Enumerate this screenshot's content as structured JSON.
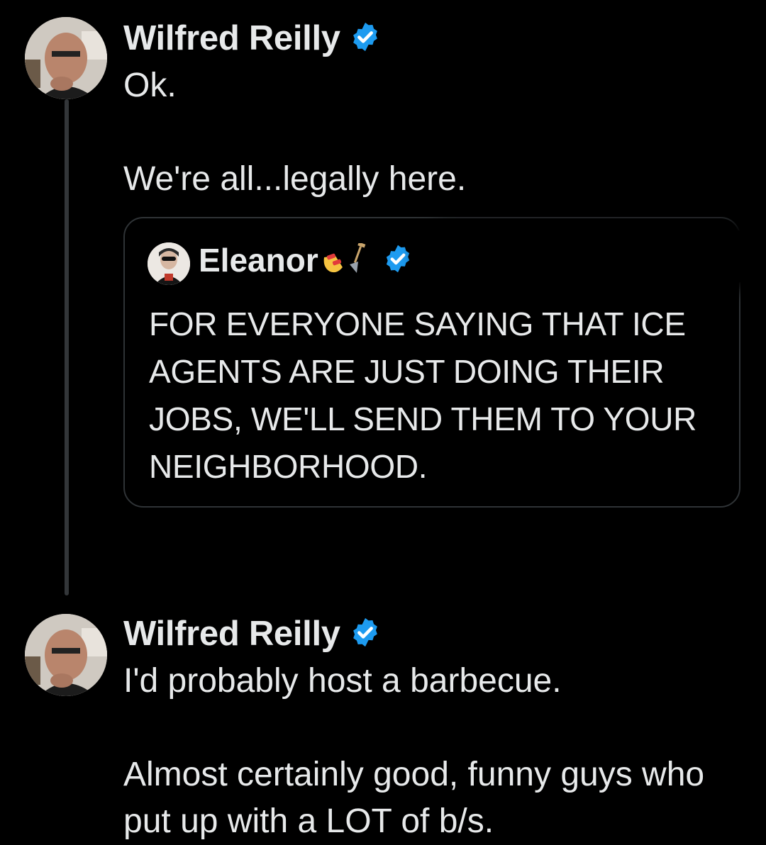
{
  "tweets": [
    {
      "author": "Wilfred Reilly",
      "verified_icon": "verified-badge-icon",
      "text": "Ok.\n\nWe're all...legally here."
    },
    {
      "author": "Wilfred Reilly",
      "verified_icon": "verified-badge-icon",
      "text": "I'd probably host a barbecue.\n\nAlmost certainly good, funny guys who put up with a LOT of b/s."
    }
  ],
  "quote": {
    "author": "Eleanor",
    "emoji_icons": [
      "nail-polish-icon",
      "shovel-icon"
    ],
    "verified_icon": "verified-badge-icon",
    "text": "FOR EVERYONE SAYING THAT ICE AGENTS ARE JUST DOING THEIR JOBS, WE'LL SEND THEM TO YOUR NEIGHBORHOOD."
  },
  "colors": {
    "background": "#000000",
    "text": "#e7e9ea",
    "verified": "#1d9bf0",
    "border": "#2f3336",
    "thread_line": "#333639"
  }
}
